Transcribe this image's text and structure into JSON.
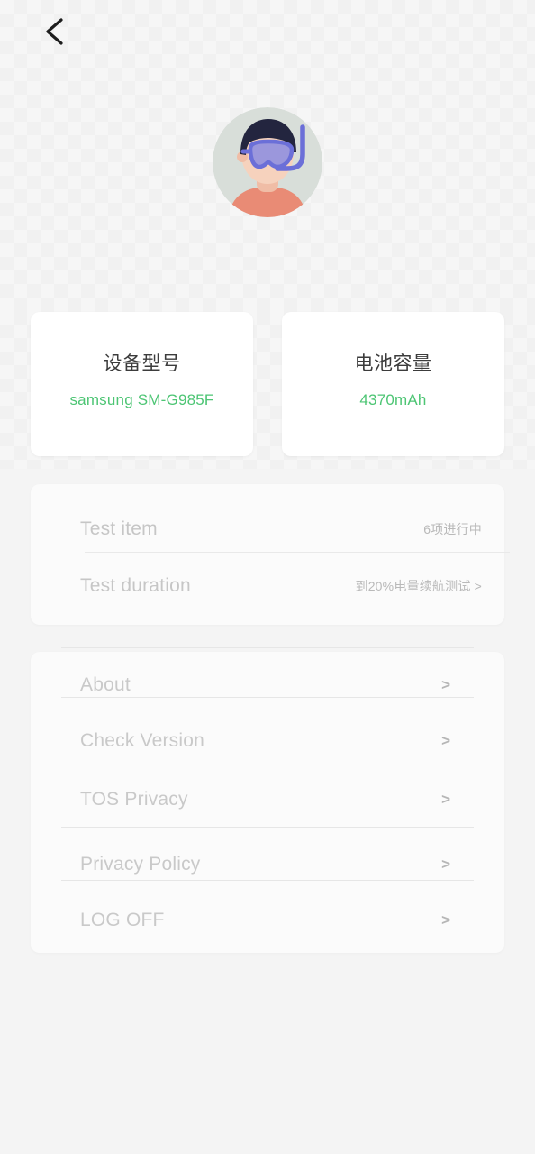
{
  "topbar": {
    "back_icon": "chevron-left-icon",
    "back_label": ""
  },
  "profile": {
    "avatar_icon": "avatar-snorkel-illustration",
    "avatar_colors": {
      "background": "#d8ded9",
      "hair": "#23253f",
      "skin": "#f6d2bd",
      "shirt": "#e98b75",
      "mask_frame": "#6b6fd8",
      "mask_lens": "#9b97dc"
    }
  },
  "info_cards": [
    {
      "title": "设备型号",
      "value": "samsung SM-G985F",
      "value_color": "#4dc574",
      "name": "device-model-card"
    },
    {
      "title": "电池容量",
      "value": "4370mAh",
      "value_color": "#4dc574",
      "name": "battery-capacity-card"
    }
  ],
  "test_section": {
    "rows": [
      {
        "label": "Test item",
        "value": "6项进行中",
        "name": "test-item-row"
      },
      {
        "label": "Test duration",
        "value": "到20%电量续航测试 >",
        "name": "test-duration-row"
      }
    ]
  },
  "menu": {
    "chevron": ">",
    "items": [
      {
        "label": "About",
        "name": "menu-item-about"
      },
      {
        "label": "Check Version",
        "name": "menu-item-check-version"
      },
      {
        "label": "TOS Privacy",
        "name": "menu-item-tos-privacy"
      },
      {
        "label": "Privacy Policy",
        "name": "menu-item-privacy-policy"
      },
      {
        "label": "LOG OFF",
        "name": "menu-item-log-off"
      }
    ]
  },
  "theme": {
    "page_background": "#f4f4f4",
    "card_background": "#ffffff",
    "muted_text": "#c6c6c6",
    "title_text": "#3c3c3c",
    "accent_green": "#4dc574"
  }
}
